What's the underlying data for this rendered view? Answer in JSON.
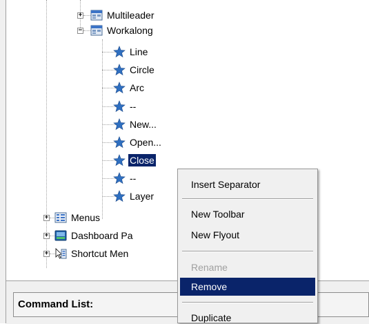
{
  "tree": {
    "groups": [
      {
        "label": "Multileader",
        "expanded": false,
        "icon": "toolbar-icon"
      },
      {
        "label": "Workalong",
        "expanded": true,
        "icon": "toolbar-icon"
      }
    ],
    "workalong_items": [
      {
        "label": "Line",
        "icon": "star-icon"
      },
      {
        "label": "Circle",
        "icon": "star-icon"
      },
      {
        "label": "Arc",
        "icon": "star-icon"
      },
      {
        "label": "--",
        "icon": "star-icon"
      },
      {
        "label": "New...",
        "icon": "star-icon"
      },
      {
        "label": "Open...",
        "icon": "star-icon"
      },
      {
        "label": "Close",
        "icon": "star-icon",
        "selected": true
      },
      {
        "label": "--",
        "icon": "star-icon"
      },
      {
        "label": "Layer",
        "icon": "star-icon"
      }
    ],
    "root_items": [
      {
        "label": "Menus",
        "icon": "menu-icon"
      },
      {
        "label": "Dashboard Pa",
        "icon": "dashboard-icon"
      },
      {
        "label": "Shortcut Men",
        "icon": "shortcut-menu-icon"
      }
    ]
  },
  "command_list": {
    "label": "Command List:"
  },
  "context_menu": {
    "items": [
      {
        "label": "Insert Separator",
        "enabled": true
      },
      {
        "label": "New Toolbar",
        "enabled": true
      },
      {
        "label": "New Flyout",
        "enabled": true
      },
      {
        "label": "Rename",
        "enabled": false
      },
      {
        "label": "Remove",
        "enabled": true,
        "highlighted": true
      },
      {
        "label": "Duplicate",
        "enabled": true
      }
    ]
  },
  "colors": {
    "selection": "#0a246a",
    "star": "#2f6fc0",
    "menu_bg": "#f0f0f0"
  }
}
